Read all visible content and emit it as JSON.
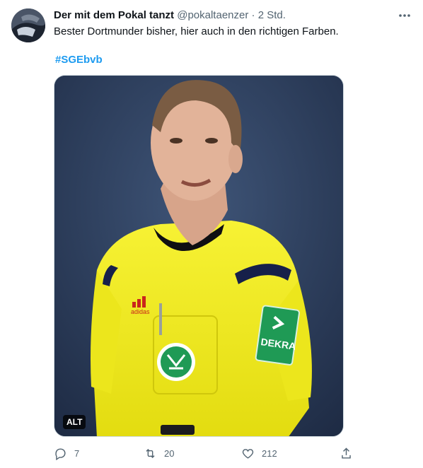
{
  "tweet": {
    "display_name": "Der mit dem Pokal tanzt",
    "handle": "@pokaltaenzer",
    "separator": "·",
    "time": "2 Std.",
    "text": "Bester Dortmunder bisher, hier auch in den richtigen Farben.",
    "hashtag": "#SGEbvb",
    "media": {
      "alt_badge": "ALT",
      "logo_brand": "adidas",
      "sleeve_patch": "DEKRA"
    },
    "actions": {
      "replies": "7",
      "retweets": "20",
      "likes": "212"
    }
  },
  "colors": {
    "accent": "#1d9bf0",
    "secondary_text": "#536471",
    "jersey": "#f2ec1b",
    "badge_green": "#1f9a55"
  },
  "icons": [
    "more-icon",
    "reply-icon",
    "retweet-icon",
    "like-icon",
    "share-icon"
  ]
}
